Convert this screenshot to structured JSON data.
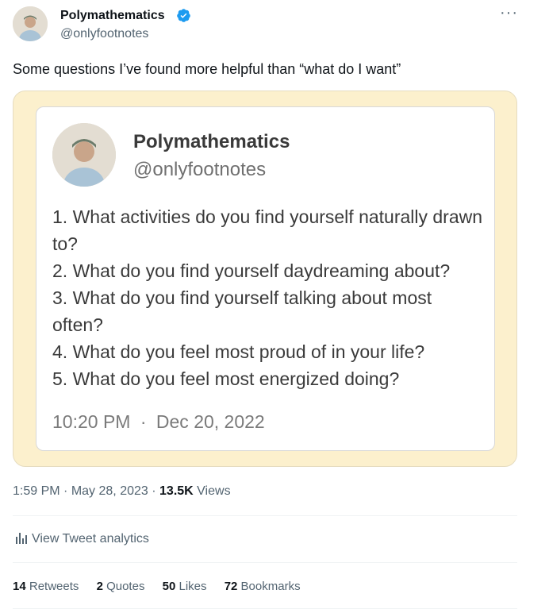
{
  "tweet": {
    "author_name": "Polymathematics",
    "author_handle": "@onlyfootnotes",
    "text": "Some questions I’ve found more helpful than “what do I want”",
    "time": "1:59 PM",
    "date": "May 28, 2023",
    "views_count": "13.5K",
    "views_label": "Views",
    "analytics_label": "View Tweet analytics",
    "more_label": "···",
    "accent_color": "#1d9bf0"
  },
  "image_card": {
    "name": "Polymathematics",
    "handle": "@onlyfootnotes",
    "questions": [
      "1. What activities do you find yourself naturally drawn to?",
      "2. What do you find yourself daydreaming about?",
      "3. What do you find yourself talking about most often?",
      "4. What do you feel most proud of in your life?",
      "5. What do you feel most energized doing?"
    ],
    "time": "10:20 PM",
    "separator": "·",
    "date": "Dec 20, 2022",
    "background_color": "#fcf0cd"
  },
  "stats": {
    "retweets_count": "14",
    "retweets_label": "Retweets",
    "quotes_count": "2",
    "quotes_label": "Quotes",
    "likes_count": "50",
    "likes_label": "Likes",
    "bookmarks_count": "72",
    "bookmarks_label": "Bookmarks"
  }
}
